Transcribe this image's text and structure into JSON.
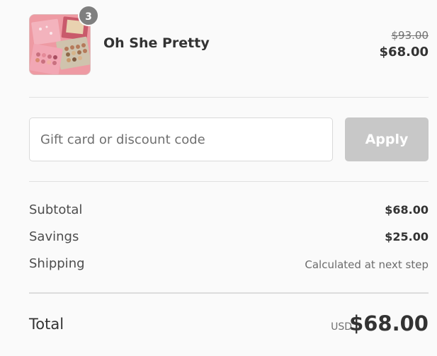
{
  "product": {
    "name": "Oh She Pretty",
    "quantity": "3",
    "original_price": "$93.00",
    "price": "$68.00",
    "image": "eyeshadow-palette-image"
  },
  "discount": {
    "placeholder": "Gift card or discount code",
    "value": "",
    "apply_label": "Apply"
  },
  "summary": {
    "subtotal_label": "Subtotal",
    "subtotal_value": "$68.00",
    "savings_label": "Savings",
    "savings_value": "$25.00",
    "shipping_label": "Shipping",
    "shipping_value": "Calculated at next step"
  },
  "total": {
    "label": "Total",
    "currency": "USD",
    "amount": "$68.00"
  },
  "colors": {
    "background": "#fafafa",
    "apply_disabled": "#c8c8c8",
    "badge": "#7f7f7f"
  }
}
